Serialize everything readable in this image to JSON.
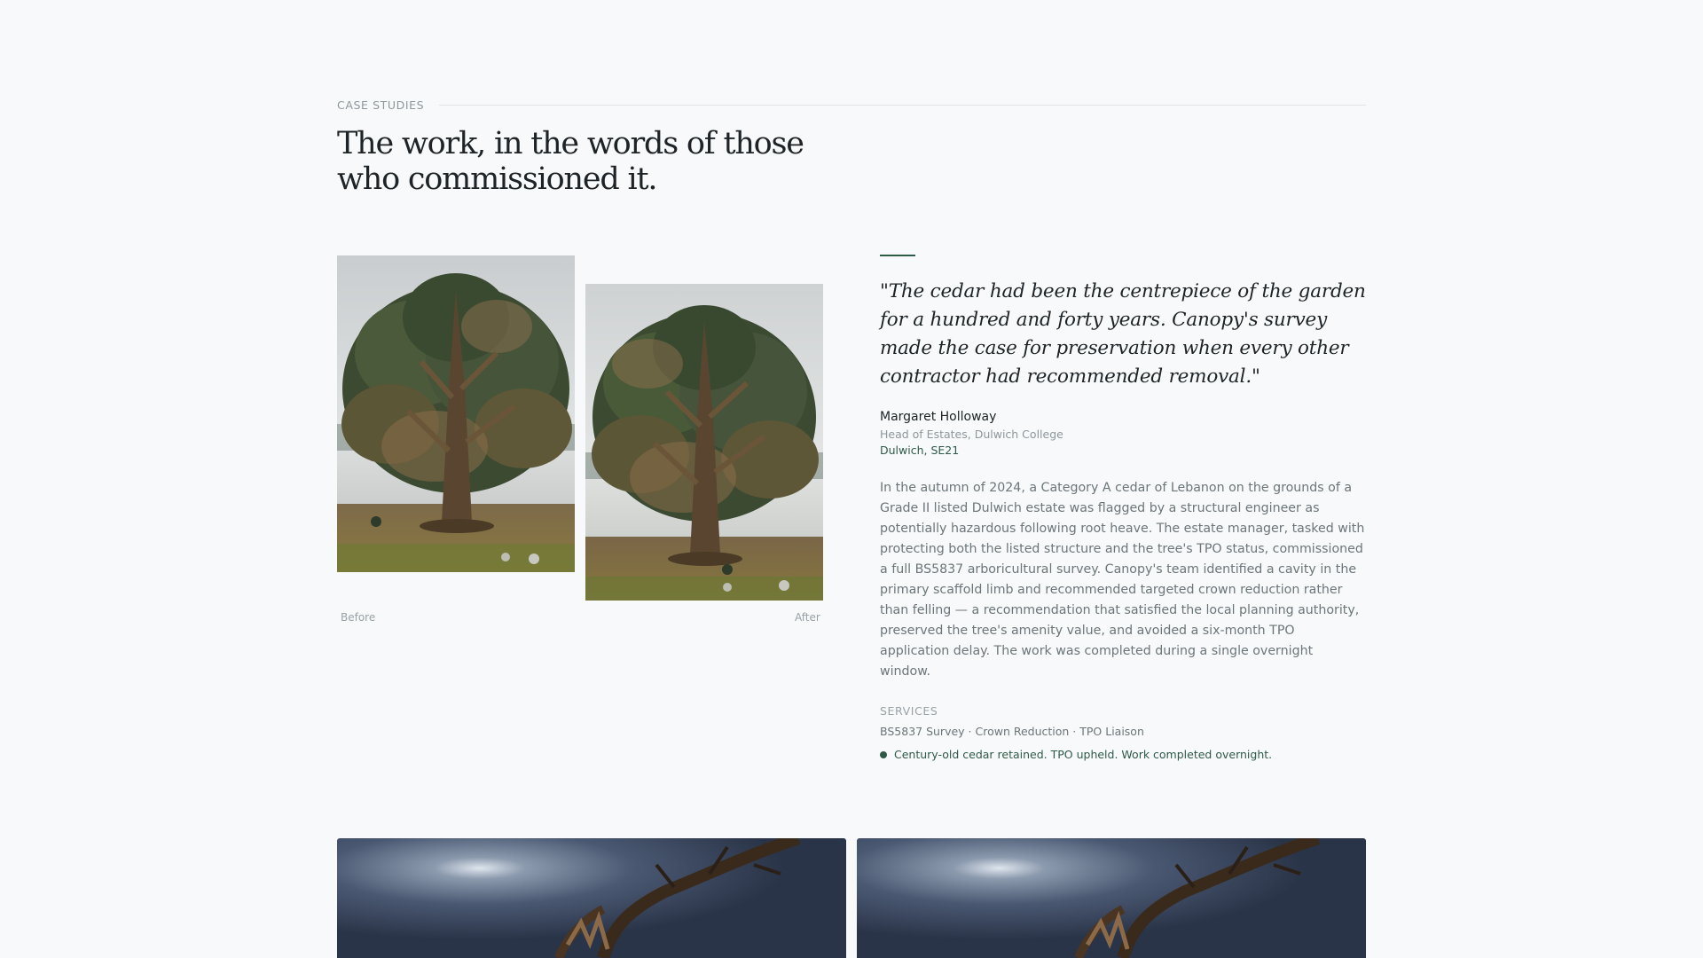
{
  "section": {
    "eyebrow": "CASE STUDIES",
    "headline": "The work, in the words of those who commissioned it."
  },
  "case_study": {
    "photos": {
      "before_caption": "Before",
      "after_caption": "After"
    },
    "quote": "\"The cedar had been the centrepiece of the garden for a hundred and forty years. Canopy's survey made the case for preservation when every other contractor had recommended removal.\"",
    "author": {
      "name": "Margaret Holloway",
      "role": "Head of Estates, Dulwich College",
      "location": "Dulwich, SE21"
    },
    "body": "In the autumn of 2024, a Category A cedar of Lebanon on the grounds of a Grade II listed Dulwich estate was flagged by a structural engineer as potentially hazardous following root heave. The estate manager, tasked with protecting both the listed structure and the tree's TPO status, commissioned a full BS5837 arboricultural survey. Canopy's team identified a cavity in the primary scaffold limb and recommended targeted crown reduction rather than felling — a recommendation that satisfied the local planning authority, preserved the tree's amenity value, and avoided a six-month TPO application delay. The work was completed during a single overnight window.",
    "services_label": "SERVICES",
    "services": "BS5837 Survey · Crown Reduction · TPO Liaison",
    "outcome": "Century-old cedar retained. TPO upheld. Work completed overnight."
  },
  "colors": {
    "accent": "#2f5a48",
    "background": "#f7f9fa",
    "text": "#1d2326",
    "muted": "#6c7579"
  },
  "icons": {
    "outcome_marker": "dot-icon"
  }
}
